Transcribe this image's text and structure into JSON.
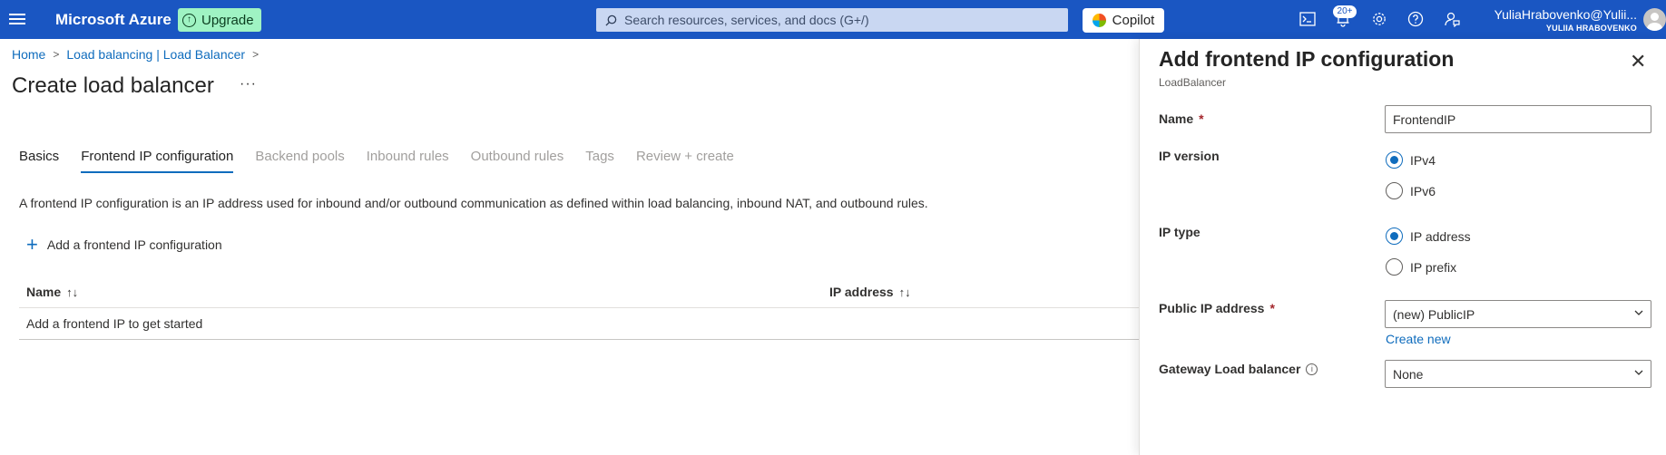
{
  "topbar": {
    "menu_icon": "hamburger-menu-icon",
    "brand": "Microsoft Azure",
    "upgrade_label": "Upgrade",
    "search_placeholder": "Search resources, services, and docs (G+/)",
    "copilot_label": "Copilot",
    "notifications_badge": "20+",
    "account_email": "YuliaHrabovenko@Yulii...",
    "account_directory": "YULIIA HRABOVENKO"
  },
  "breadcrumb": {
    "items": [
      "Home",
      "Load balancing | Load Balancer"
    ]
  },
  "page": {
    "title": "Create load balancer",
    "more_label": "···"
  },
  "tabs": [
    {
      "label": "Basics",
      "state": "enabled"
    },
    {
      "label": "Frontend IP configuration",
      "state": "active"
    },
    {
      "label": "Backend pools",
      "state": "disabled"
    },
    {
      "label": "Inbound rules",
      "state": "disabled"
    },
    {
      "label": "Outbound rules",
      "state": "disabled"
    },
    {
      "label": "Tags",
      "state": "disabled"
    },
    {
      "label": "Review + create",
      "state": "disabled"
    }
  ],
  "main": {
    "description": "A frontend IP configuration is an IP address used for inbound and/or outbound communication as defined within load balancing, inbound NAT, and outbound rules.",
    "add_button_label": "Add a frontend IP configuration",
    "table": {
      "columns": [
        "Name",
        "IP address"
      ],
      "empty_text": "Add a frontend IP to get started"
    }
  },
  "panel": {
    "title": "Add frontend IP configuration",
    "subtitle": "LoadBalancer",
    "name_label": "Name",
    "name_value": "FrontendIP",
    "ip_version_label": "IP version",
    "ip_version_options": [
      "IPv4",
      "IPv6"
    ],
    "ip_version_selected": "IPv4",
    "ip_type_label": "IP type",
    "ip_type_options": [
      "IP address",
      "IP prefix"
    ],
    "ip_type_selected": "IP address",
    "public_ip_label": "Public IP address",
    "public_ip_value": "(new) PublicIP",
    "create_new_label": "Create new",
    "gateway_label": "Gateway Load balancer",
    "gateway_value": "None",
    "required_marker": "*"
  },
  "colors": {
    "topbar": "#1a56c2",
    "accent": "#0f6cbd",
    "upgrade": "#9ff3c3",
    "required": "#a4262c"
  }
}
